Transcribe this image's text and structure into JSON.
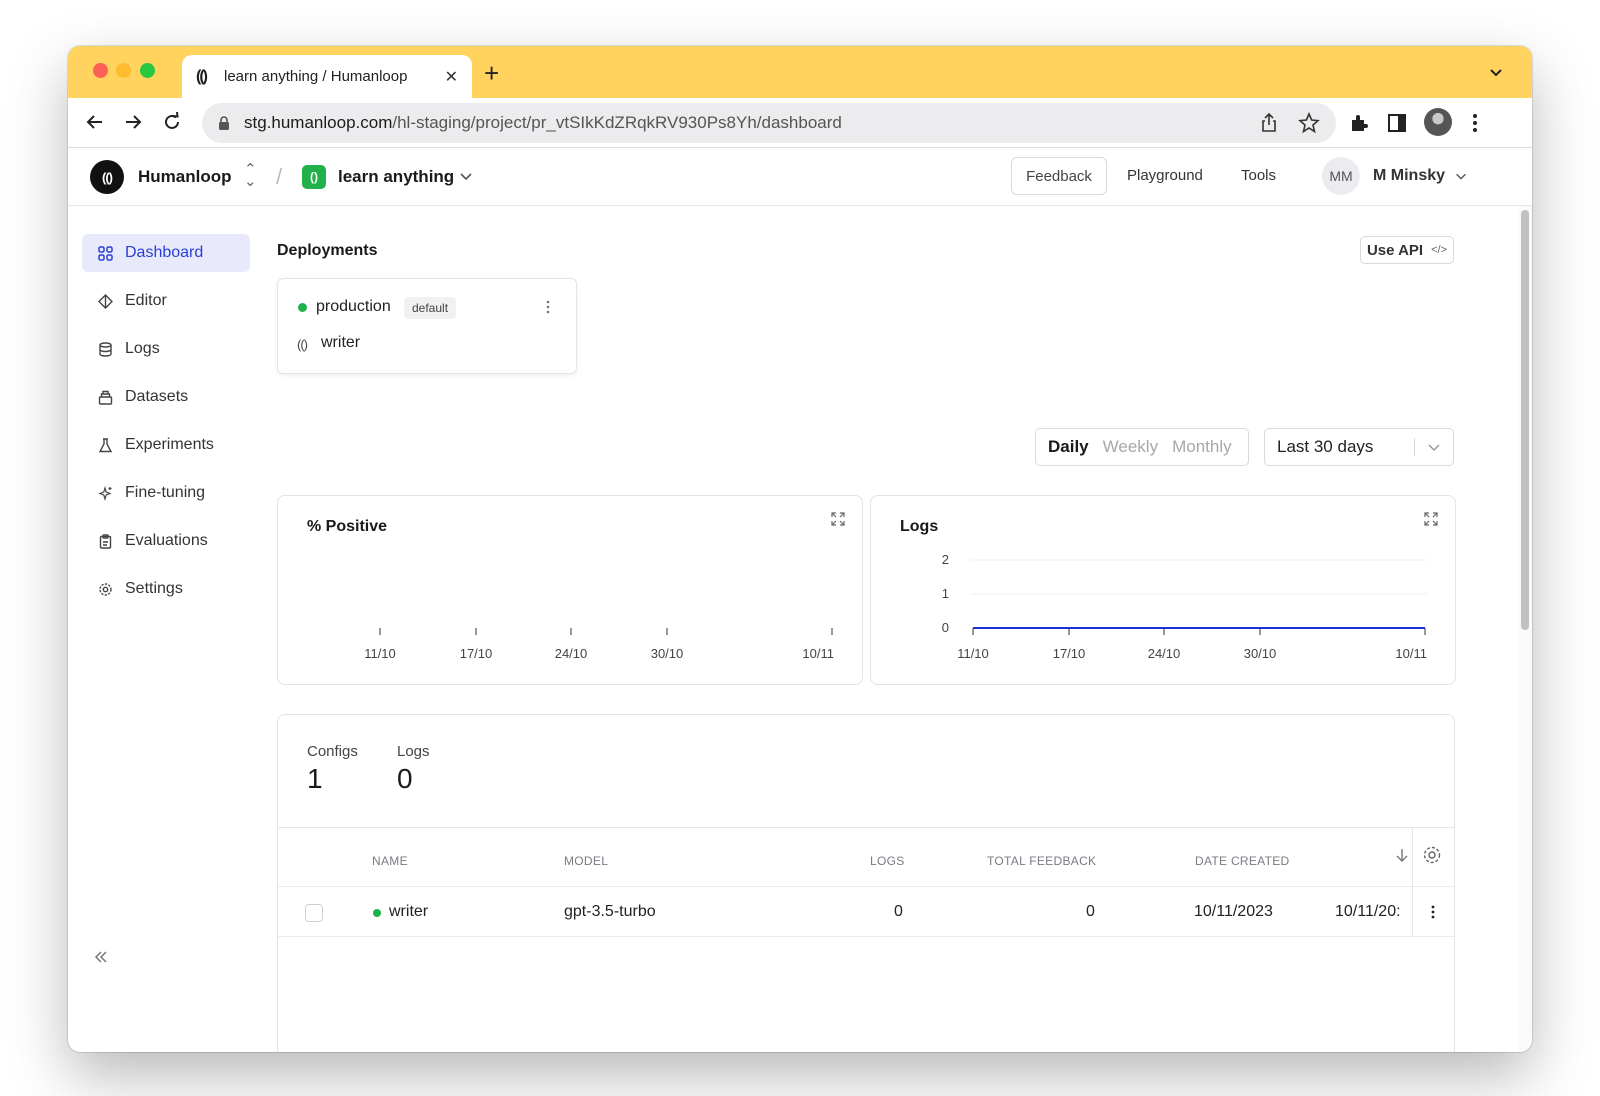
{
  "browser": {
    "tab_title": "learn anything / Humanloop",
    "tab_close": "✕",
    "new_tab": "+",
    "url_host": "stg.humanloop.com",
    "url_path": "/hl-staging/project/pr_vtSIkKdZRqkRV930Ps8Yh/dashboard"
  },
  "header": {
    "org_name": "Humanloop",
    "org_logo_text": "(()",
    "separator": "/",
    "project_name": "learn anything",
    "project_logo_text": "()",
    "feedback_label": "Feedback",
    "playground_label": "Playground",
    "tools_label": "Tools",
    "user_initials": "MM",
    "user_name": "M Minsky"
  },
  "sidebar": {
    "items": [
      {
        "label": "Dashboard",
        "icon": "dashboard-icon",
        "active": true
      },
      {
        "label": "Editor",
        "icon": "editor-icon"
      },
      {
        "label": "Logs",
        "icon": "logs-icon"
      },
      {
        "label": "Datasets",
        "icon": "datasets-icon"
      },
      {
        "label": "Experiments",
        "icon": "flask-icon"
      },
      {
        "label": "Fine-tuning",
        "icon": "sparkle-icon"
      },
      {
        "label": "Evaluations",
        "icon": "clipboard-icon"
      },
      {
        "label": "Settings",
        "icon": "gear-icon"
      }
    ]
  },
  "main": {
    "deployments_title": "Deployments",
    "use_api_label": "Use API",
    "use_api_code": "</>",
    "deployment": {
      "environment": "production",
      "badge": "default",
      "config_icon_text": "(()",
      "config_name": "writer"
    },
    "granularity": {
      "daily": "Daily",
      "weekly": "Weekly",
      "monthly": "Monthly",
      "selected": "Daily"
    },
    "date_range": "Last 30 days"
  },
  "chart_data": [
    {
      "type": "line",
      "title": "% Positive",
      "x_ticks": [
        "11/10",
        "17/10",
        "24/10",
        "30/10",
        "10/11"
      ],
      "series": []
    },
    {
      "type": "line",
      "title": "Logs",
      "x_ticks": [
        "11/10",
        "17/10",
        "24/10",
        "30/10",
        "10/11"
      ],
      "y_ticks": [
        "0",
        "1",
        "2"
      ],
      "ylim": [
        0,
        2
      ],
      "grid": true,
      "series": [
        {
          "color": "#1f2fd6",
          "x": [
            "11/10",
            "10/11"
          ],
          "values": [
            0,
            0
          ]
        }
      ]
    }
  ],
  "stats": {
    "configs_label": "Configs",
    "configs_value": "1",
    "logs_label": "Logs",
    "logs_value": "0"
  },
  "table": {
    "columns": [
      "NAME",
      "MODEL",
      "LOGS",
      "TOTAL FEEDBACK",
      "DATE CREATED"
    ],
    "rows": [
      {
        "name": "writer",
        "model": "gpt-3.5-turbo",
        "logs": "0",
        "total_feedback": "0",
        "date_created": "10/11/2023",
        "last_col": "10/11/20:"
      }
    ]
  }
}
